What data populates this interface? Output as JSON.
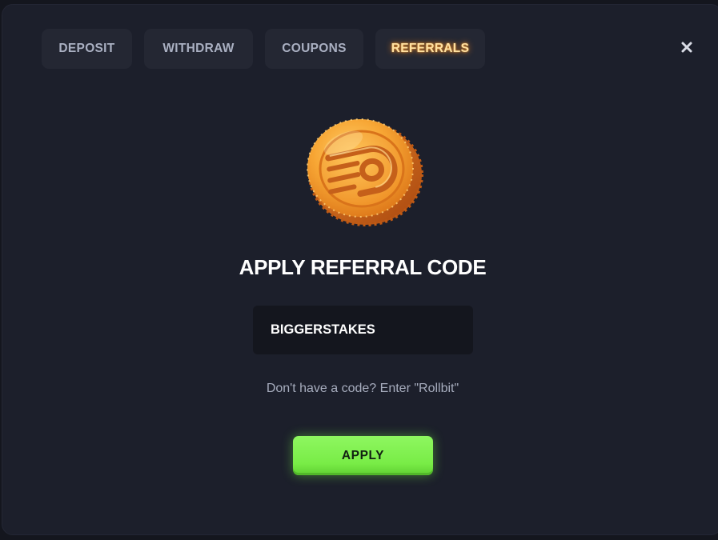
{
  "tabs": [
    {
      "label": "DEPOSIT",
      "active": false
    },
    {
      "label": "WITHDRAW",
      "active": false
    },
    {
      "label": "COUPONS",
      "active": false
    },
    {
      "label": "REFERRALS",
      "active": true
    }
  ],
  "close_icon": "close-icon",
  "coin_icon": "rollbit-coin-icon",
  "heading": "APPLY REFERRAL CODE",
  "referral_input": {
    "value": "BIGGERSTAKES"
  },
  "hint": "Don't have a code? Enter \"Rollbit\"",
  "apply_label": "APPLY",
  "colors": {
    "background": "#14161e",
    "panel": "#1c1f2b",
    "tab": "#242733",
    "active_tab_text": "#ffe0a0",
    "active_tab_glow": "#ff8c1e",
    "apply_button": "#79ec47",
    "coin": "#f29a2a"
  }
}
